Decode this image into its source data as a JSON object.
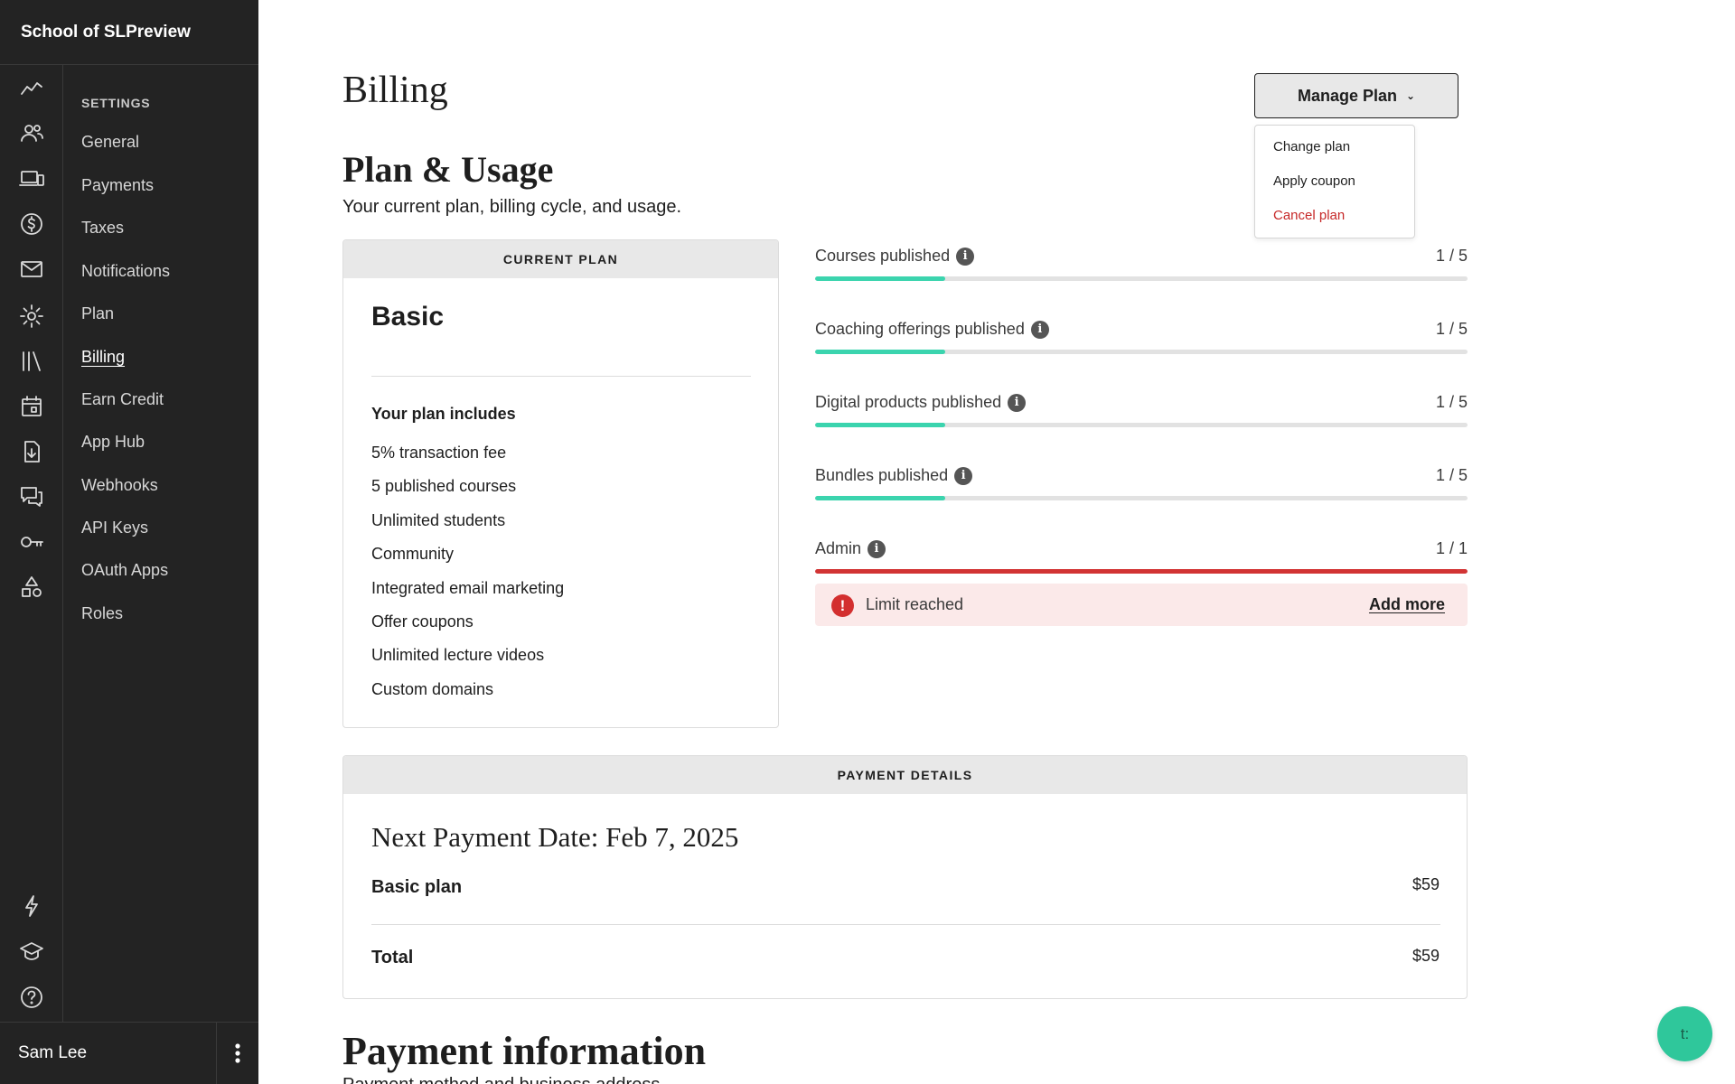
{
  "sidebar": {
    "school_name": "School of SLPreview",
    "settings_title": "SETTINGS",
    "rail_icons": [
      "analytics-icon",
      "users-icon",
      "devices-icon",
      "dollar-icon",
      "mail-icon",
      "gear-icon",
      "library-icon",
      "calendar-icon",
      "download-icon",
      "comments-icon",
      "key-icon",
      "shapes-icon",
      "lightning-icon",
      "graduation-cap-icon",
      "help-icon"
    ],
    "items": [
      {
        "label": "General"
      },
      {
        "label": "Payments"
      },
      {
        "label": "Taxes"
      },
      {
        "label": "Notifications"
      },
      {
        "label": "Plan"
      },
      {
        "label": "Billing"
      },
      {
        "label": "Earn Credit"
      },
      {
        "label": "App Hub"
      },
      {
        "label": "Webhooks"
      },
      {
        "label": "API Keys"
      },
      {
        "label": "OAuth Apps"
      },
      {
        "label": "Roles"
      }
    ],
    "active_item": "Billing",
    "user_name": "Sam Lee"
  },
  "header": {
    "title": "Billing",
    "manage_plan_label": "Manage Plan"
  },
  "dropdown": {
    "items": [
      {
        "label": "Change plan"
      },
      {
        "label": "Apply coupon"
      },
      {
        "label": "Cancel plan"
      }
    ]
  },
  "plan_usage": {
    "title": "Plan & Usage",
    "subtitle": "Your current plan, billing cycle, and usage."
  },
  "current_plan": {
    "header": "CURRENT PLAN",
    "name": "Basic",
    "includes_title": "Your plan includes",
    "features": [
      "5% transaction fee",
      "5 published courses",
      "Unlimited students",
      "Community",
      "Integrated email marketing",
      "Offer coupons",
      "Unlimited lecture videos",
      "Custom domains"
    ]
  },
  "usage": [
    {
      "label": "Courses published",
      "count": "1 / 5",
      "fraction": 0.2
    },
    {
      "label": "Coaching offerings published",
      "count": "1 / 5",
      "fraction": 0.2
    },
    {
      "label": "Digital products published",
      "count": "1 / 5",
      "fraction": 0.2
    },
    {
      "label": "Bundles published",
      "count": "1 / 5",
      "fraction": 0.2
    },
    {
      "label": "Admin",
      "count": "1 / 1",
      "fraction": 1.0
    }
  ],
  "limit_alert": {
    "text": "Limit reached",
    "action": "Add more"
  },
  "payment_details": {
    "header": "PAYMENT DETAILS",
    "next_payment": "Next Payment Date: Feb 7, 2025",
    "line_label": "Basic plan",
    "line_amount": "$59",
    "total_label": "Total",
    "total_amount": "$59"
  },
  "payment_information": {
    "title": "Payment information",
    "subtitle": "Payment method and business address"
  },
  "chat": {
    "label": "t:"
  },
  "colors": {
    "sidebar_bg": "#232323",
    "progress": "#3bd4ae",
    "danger": "#d23434",
    "alert_bg": "#fbe9e9",
    "fab": "#2fc79b"
  }
}
